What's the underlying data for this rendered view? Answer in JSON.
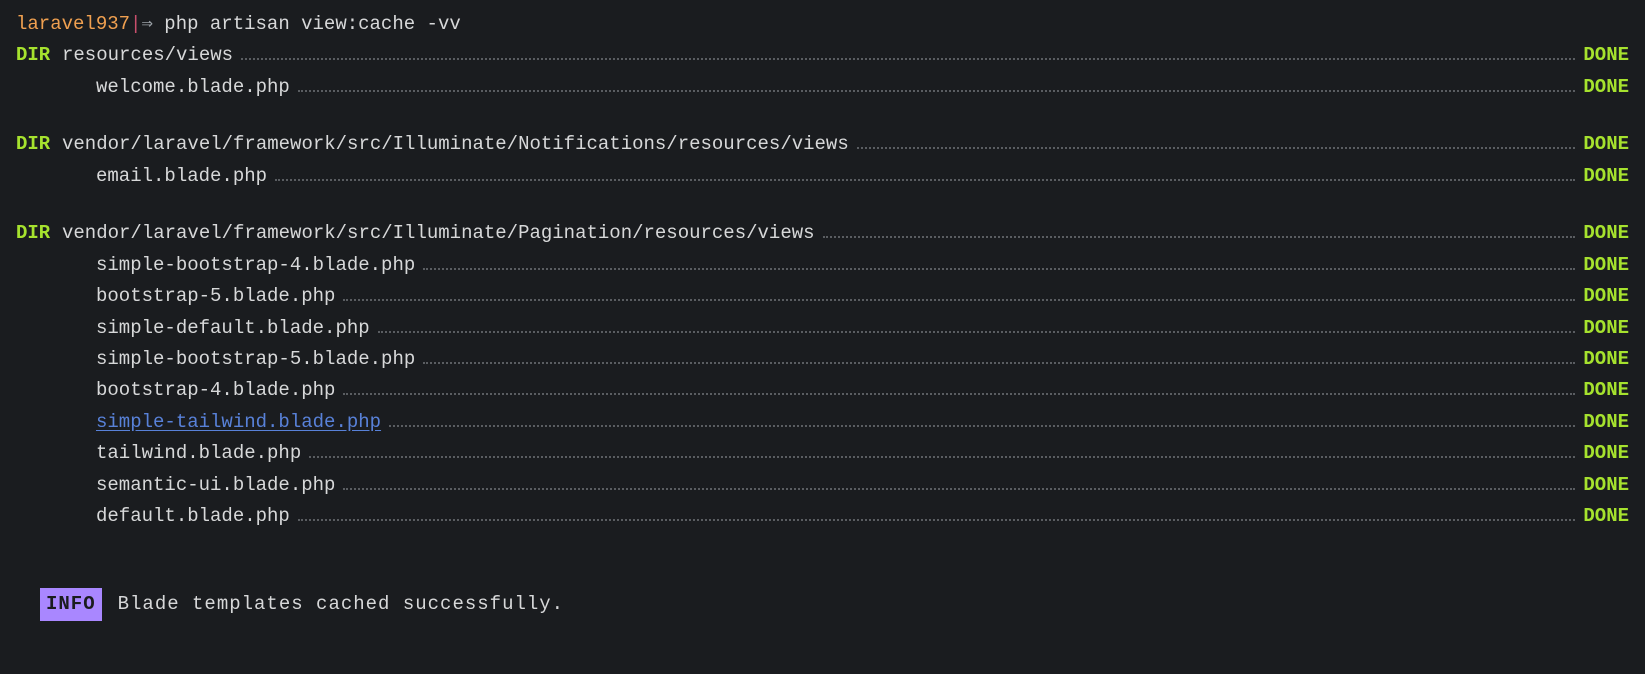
{
  "prompt": {
    "cwd": "laravel937",
    "pipe": "|",
    "arrow": "⇒",
    "command": "php artisan view:cache -vv"
  },
  "labels": {
    "dir": "DIR",
    "done": "DONE"
  },
  "groups": [
    {
      "dir": "resources/views",
      "files": [
        {
          "name": "welcome.blade.php",
          "link": false
        }
      ]
    },
    {
      "dir": "vendor/laravel/framework/src/Illuminate/Notifications/resources/views",
      "files": [
        {
          "name": "email.blade.php",
          "link": false
        }
      ]
    },
    {
      "dir": "vendor/laravel/framework/src/Illuminate/Pagination/resources/views",
      "files": [
        {
          "name": "simple-bootstrap-4.blade.php",
          "link": false
        },
        {
          "name": "bootstrap-5.blade.php",
          "link": false
        },
        {
          "name": "simple-default.blade.php",
          "link": false
        },
        {
          "name": "simple-bootstrap-5.blade.php",
          "link": false
        },
        {
          "name": "bootstrap-4.blade.php",
          "link": false
        },
        {
          "name": "simple-tailwind.blade.php",
          "link": true
        },
        {
          "name": "tailwind.blade.php",
          "link": false
        },
        {
          "name": "semantic-ui.blade.php",
          "link": false
        },
        {
          "name": "default.blade.php",
          "link": false
        }
      ]
    }
  ],
  "info": {
    "badge": "INFO",
    "message": "Blade templates cached successfully."
  }
}
